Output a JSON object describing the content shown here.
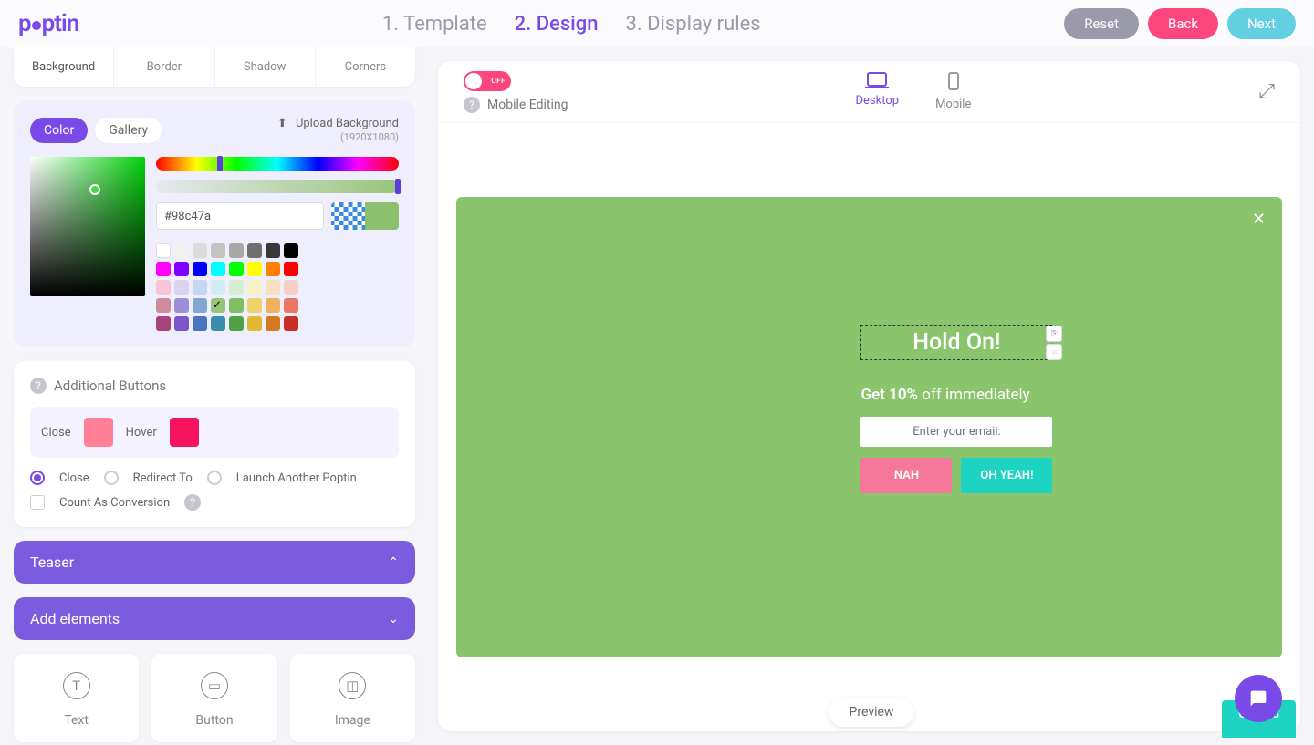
{
  "header": {
    "logo": "poptin",
    "steps": [
      "1. Template",
      "2. Design",
      "3. Display rules"
    ],
    "active_step": 1,
    "reset": "Reset",
    "back": "Back",
    "next": "Next"
  },
  "style_tabs": {
    "items": [
      "Background",
      "Border",
      "Shadow",
      "Corners"
    ],
    "active": 0
  },
  "color_panel": {
    "color_pill": "Color",
    "gallery_pill": "Gallery",
    "upload_label": "Upload Background",
    "upload_size": "(1920X1080)",
    "hex_value": "#98c47a",
    "swatches": [
      [
        "#ffffff",
        "#f1f1f1",
        "#dcdcdc",
        "#c3c3c3",
        "#a8a8a8",
        "#707070",
        "#383838",
        "#000000"
      ],
      [
        "#ff00ff",
        "#8000ff",
        "#0000ff",
        "#00ffff",
        "#00ff00",
        "#ffff00",
        "#ff8000",
        "#ff0000"
      ],
      [
        "#f7c5d7",
        "#dcd2f2",
        "#c6d7f2",
        "#d1ecf2",
        "#d6edd0",
        "#f6f1c7",
        "#f7dfc1",
        "#f7cfc7"
      ],
      [
        "#d08aa0",
        "#9d8ed6",
        "#82a7d1",
        "#98c47a",
        "#7cc062",
        "#efd26a",
        "#f0b25f",
        "#ea7764"
      ],
      [
        "#a64579",
        "#7a56c8",
        "#4a74c0",
        "#3a8ead",
        "#51a043",
        "#e0b832",
        "#d57a22",
        "#c93025"
      ]
    ],
    "selected_swatch": "#98c47a"
  },
  "additional_buttons": {
    "title": "Additional Buttons",
    "close_label": "Close",
    "hover_label": "Hover",
    "close_color": "#ff8097",
    "hover_color": "#f5145d",
    "actions": {
      "close": "Close",
      "redirect": "Redirect To",
      "launch": "Launch Another Poptin",
      "count": "Count As Conversion"
    }
  },
  "accordion": {
    "teaser": "Teaser",
    "add": "Add elements"
  },
  "elements": {
    "text": "Text",
    "button": "Button",
    "image": "Image"
  },
  "canvas": {
    "mobile_editing": "Mobile Editing",
    "toggle": "OFF",
    "desktop": "Desktop",
    "mobile": "Mobile",
    "preview": "Preview",
    "guides": "GUIDES"
  },
  "popup": {
    "title": "Hold On!",
    "sub_bold": "Get 10%",
    "sub_rest": " off immediately",
    "email_placeholder": "Enter your email:",
    "nah": "NAH",
    "yeah": "OH YEAH!"
  }
}
